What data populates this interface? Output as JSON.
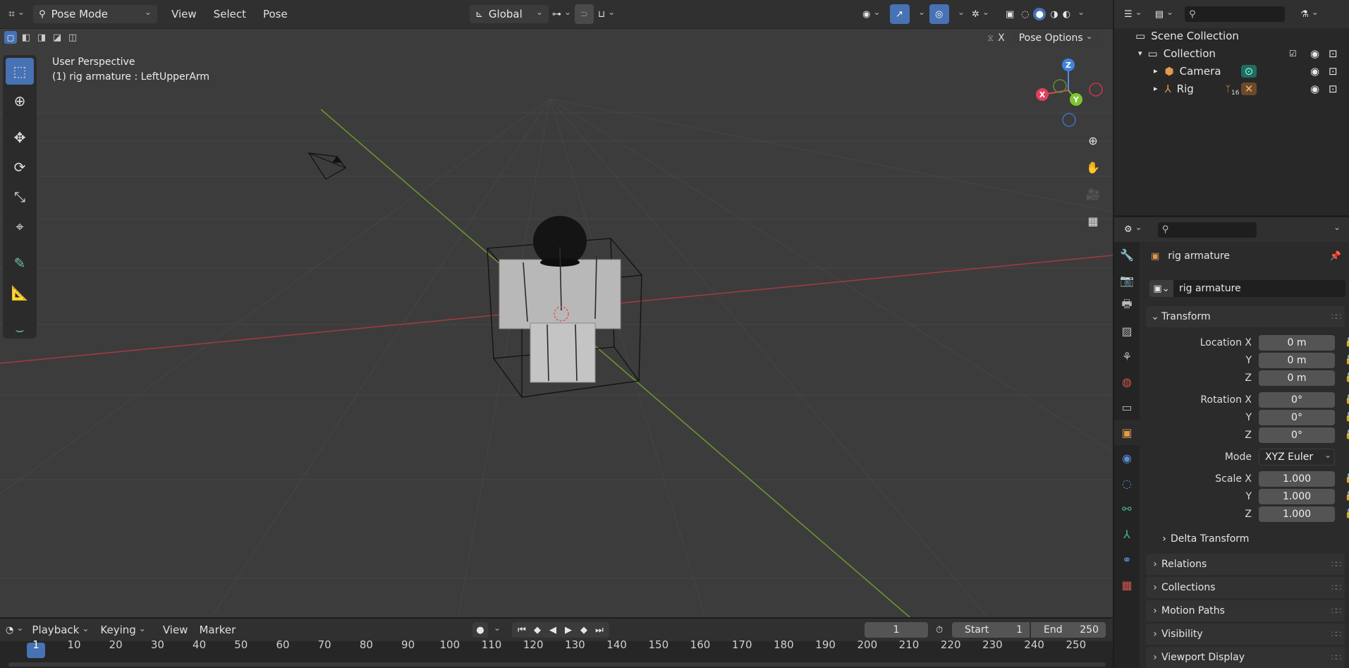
{
  "viewport": {
    "mode": "Pose Mode",
    "menus": [
      "View",
      "Select",
      "Pose"
    ],
    "orientation": "Global",
    "pose_options": "Pose Options",
    "x_label": "X",
    "perspective": "User Perspective",
    "active_info": "(1) rig armature : LeftUpperArm",
    "gizmo": {
      "x": "X",
      "y": "Y",
      "z": "Z"
    },
    "colors": {
      "x_axis": "#b8434f",
      "y_axis": "#6aa235",
      "accent": "#4772b3"
    }
  },
  "outliner": {
    "rows": [
      {
        "label": "Scene Collection"
      },
      {
        "label": "Collection"
      },
      {
        "label": "Camera"
      },
      {
        "label": "Rig"
      }
    ],
    "rig_badge": "16"
  },
  "properties": {
    "object_name": "rig armature",
    "data_name": "rig armature",
    "transform_title": "Transform",
    "location": {
      "label": "Location X",
      "x": "0 m",
      "y": "0 m",
      "z": "0 m"
    },
    "rotation": {
      "label": "Rotation X",
      "x": "0°",
      "y": "0°",
      "z": "0°"
    },
    "axis_y": "Y",
    "axis_z": "Z",
    "mode_label": "Mode",
    "mode_value": "XYZ Euler",
    "scale": {
      "label": "Scale X",
      "x": "1.000",
      "y": "1.000",
      "z": "1.000"
    },
    "delta_transform": "Delta Transform",
    "panels": [
      "Relations",
      "Collections",
      "Motion Paths",
      "Visibility",
      "Viewport Display"
    ]
  },
  "timeline": {
    "menus": [
      "Playback",
      "Keying",
      "View",
      "Marker"
    ],
    "current_frame": "1",
    "start_label": "Start",
    "start_value": "1",
    "end_label": "End",
    "end_value": "250",
    "ticks": [
      "1",
      "10",
      "20",
      "30",
      "40",
      "50",
      "60",
      "70",
      "80",
      "90",
      "100",
      "110",
      "120",
      "130",
      "140",
      "150",
      "160",
      "170",
      "180",
      "190",
      "200",
      "210",
      "220",
      "230",
      "240",
      "250"
    ]
  }
}
